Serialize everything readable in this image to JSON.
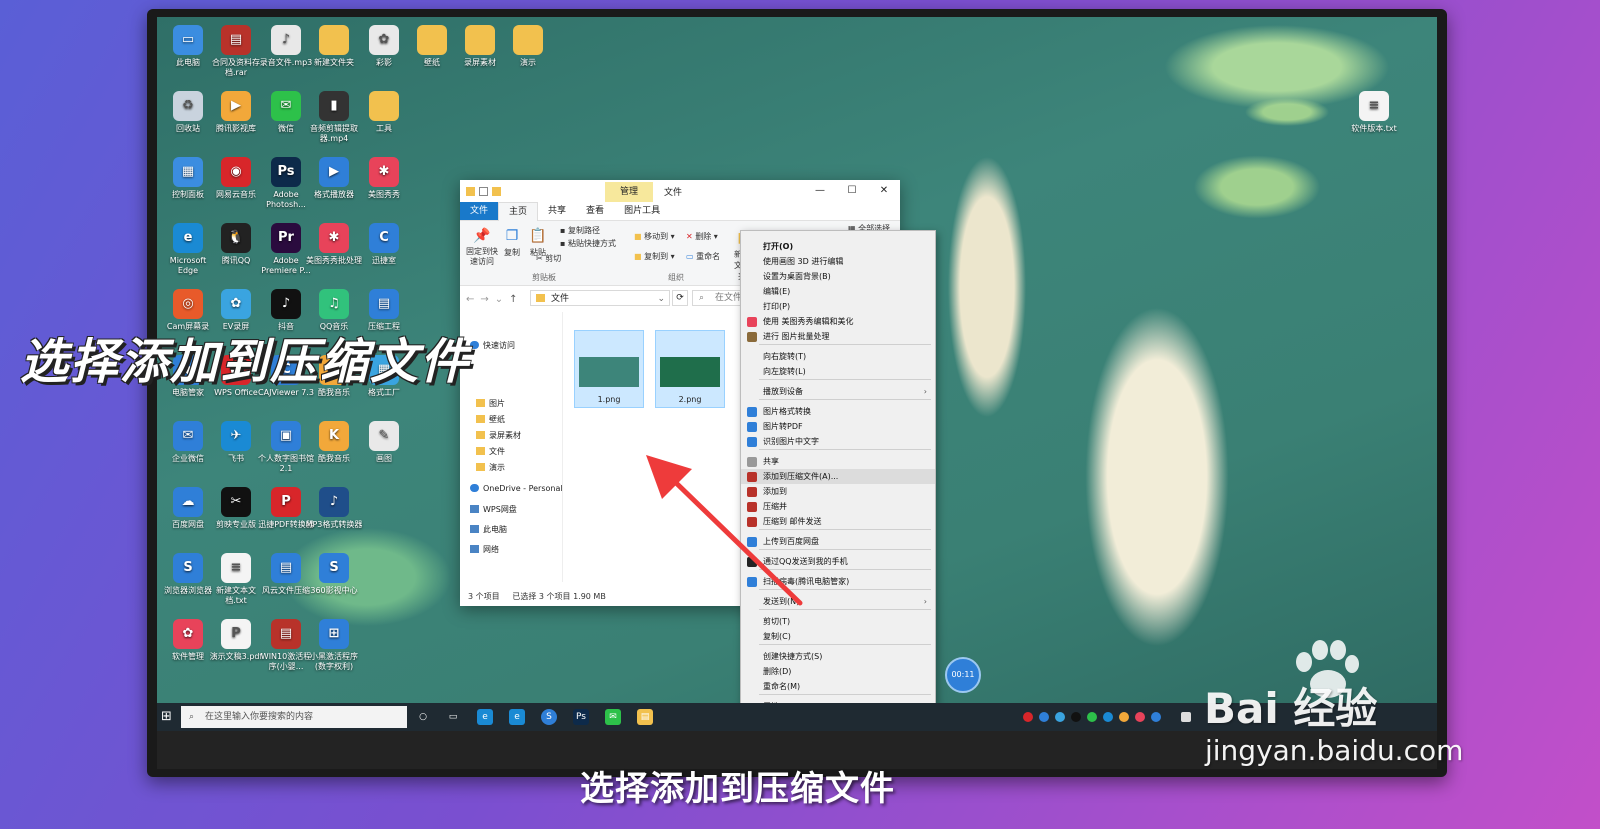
{
  "desktop_icons": [
    {
      "label": "此电脑",
      "color": "#3b8de0",
      "glyph": "▭"
    },
    {
      "label": "合同及资料存档.rar",
      "color": "#b8322a",
      "glyph": "▤"
    },
    {
      "label": "录音文件.mp3",
      "color": "#e8e8e8",
      "glyph": "♪"
    },
    {
      "label": "新建文件夹",
      "color": "#f2c14e",
      "glyph": ""
    },
    {
      "label": "彩影",
      "color": "#e9e9e9",
      "glyph": "✿"
    },
    {
      "label": "壁纸",
      "color": "#f2c14e",
      "glyph": ""
    },
    {
      "label": "录屏素材",
      "color": "#f2c14e",
      "glyph": ""
    },
    {
      "label": "演示",
      "color": "#f2c14e",
      "glyph": ""
    },
    {
      "label": "回收站",
      "color": "#c9d3de",
      "glyph": "♻"
    },
    {
      "label": "腾讯影视库",
      "color": "#f2a83a",
      "glyph": "▶"
    },
    {
      "label": "微信",
      "color": "#2dc14a",
      "glyph": "✉"
    },
    {
      "label": "音频剪辑提取器.mp4",
      "color": "#333333",
      "glyph": "▮"
    },
    {
      "label": "工具",
      "color": "#f2c14e",
      "glyph": ""
    },
    {
      "label": "控制面板",
      "color": "#3b8de0",
      "glyph": "▦"
    },
    {
      "label": "网易云音乐",
      "color": "#d8262a",
      "glyph": "◉"
    },
    {
      "label": "Adobe Photosh...",
      "color": "#0d2a4a",
      "glyph": "Ps"
    },
    {
      "label": "格式播放器",
      "color": "#2f7fd8",
      "glyph": "▶"
    },
    {
      "label": "美图秀秀",
      "color": "#e8435a",
      "glyph": "✱"
    },
    {
      "label": "Microsoft Edge",
      "color": "#1a8ad4",
      "glyph": "e"
    },
    {
      "label": "腾讯QQ",
      "color": "#222222",
      "glyph": "🐧"
    },
    {
      "label": "Adobe Premiere P...",
      "color": "#2a0b3e",
      "glyph": "Pr"
    },
    {
      "label": "美图秀秀批处理",
      "color": "#e8435a",
      "glyph": "✱"
    },
    {
      "label": "迅捷室",
      "color": "#2f7fd8",
      "glyph": "C"
    },
    {
      "label": "Cam屏幕录",
      "color": "#e85a2a",
      "glyph": "◎"
    },
    {
      "label": "EV录屏",
      "color": "#3aa4e0",
      "glyph": "✿"
    },
    {
      "label": "抖音",
      "color": "#111111",
      "glyph": "♪"
    },
    {
      "label": "QQ音乐",
      "color": "#31c27c",
      "glyph": "♫"
    },
    {
      "label": "压缩工程",
      "color": "#2f7fd8",
      "glyph": "▤"
    },
    {
      "label": "电脑管家",
      "color": "#2f7fd8",
      "glyph": "◆"
    },
    {
      "label": "WPS Office",
      "color": "#d8262a",
      "glyph": "W"
    },
    {
      "label": "CAJViewer 7.3",
      "color": "#2f7fd8",
      "glyph": "C"
    },
    {
      "label": "酷我音乐",
      "color": "#f2a83a",
      "glyph": "♫"
    },
    {
      "label": "格式工厂",
      "color": "#3aa4e0",
      "glyph": "▦"
    },
    {
      "label": "企业微信",
      "color": "#2f7fd8",
      "glyph": "✉"
    },
    {
      "label": "飞书",
      "color": "#1a8ad4",
      "glyph": "✈"
    },
    {
      "label": "个人数字图书馆2.1",
      "color": "#2f7fd8",
      "glyph": "▣"
    },
    {
      "label": "酷我音乐",
      "color": "#f2a83a",
      "glyph": "K"
    },
    {
      "label": "画图",
      "color": "#e9e9e9",
      "glyph": "✎"
    },
    {
      "label": "百度网盘",
      "color": "#2f7fd8",
      "glyph": "☁"
    },
    {
      "label": "剪映专业版",
      "color": "#111111",
      "glyph": "✂"
    },
    {
      "label": "迅捷PDF转换器",
      "color": "#d8262a",
      "glyph": "P"
    },
    {
      "label": "MP3格式转换器",
      "color": "#1f4e8a",
      "glyph": "♪"
    },
    {
      "label": "浏览器浏览器",
      "color": "#2f7fd8",
      "glyph": "S"
    },
    {
      "label": "新建文本文档.txt",
      "color": "#f4f4f4",
      "glyph": "≡"
    },
    {
      "label": "风云文件压缩",
      "color": "#2f7fd8",
      "glyph": "▤"
    },
    {
      "label": "360影视中心",
      "color": "#2f7fd8",
      "glyph": "S"
    },
    {
      "label": "软件管理",
      "color": "#e8435a",
      "glyph": "✿"
    },
    {
      "label": "演示文稿3.pdf",
      "color": "#f4f4f4",
      "glyph": "P"
    },
    {
      "label": "WIN10激活程序(小婴...",
      "color": "#b8322a",
      "glyph": "▤"
    },
    {
      "label": "小黑激活程序(数字权利)",
      "color": "#2f7fd8",
      "glyph": "⊞"
    },
    {
      "label": "软件版本.txt",
      "color": "#f4f4f4",
      "glyph": "≡"
    }
  ],
  "explorer": {
    "manage_tab": "管理",
    "title": "文件",
    "tabs": [
      "文件",
      "主页",
      "共享",
      "查看",
      "图片工具"
    ],
    "ribbon": {
      "pin": "固定到快速访问",
      "copy": "复制",
      "paste": "粘贴",
      "copy_path": "复制路径",
      "paste_shortcut": "粘贴快捷方式",
      "cut": "剪切",
      "clipboard_group": "剪贴板",
      "move_to": "移动到",
      "copy_to": "复制到",
      "delete": "删除",
      "rename": "重命名",
      "organize_group": "组织",
      "new": "新建",
      "new_folder": "文件夹",
      "select_all": "全部选择"
    },
    "address": "文件",
    "search_placeholder": "在文件中",
    "nav_items": [
      "快速访问",
      "图片",
      "壁纸",
      "录屏素材",
      "文件",
      "演示",
      "OneDrive - Personal",
      "WPS网盘",
      "此电脑",
      "网络"
    ],
    "files": [
      {
        "name": "1.png"
      },
      {
        "name": "2.png"
      }
    ],
    "status_count": "3 个项目",
    "status_selected": "已选择 3 个项目  1.90 MB"
  },
  "context_menu": {
    "items": [
      {
        "label": "打开(O)",
        "bold": true
      },
      {
        "label": "使用画图 3D 进行编辑"
      },
      {
        "label": "设置为桌面背景(B)"
      },
      {
        "label": "编辑(E)"
      },
      {
        "label": "打印(P)"
      },
      {
        "label": "使用 美图秀秀编辑和美化",
        "icon_color": "#e8435a"
      },
      {
        "label": "进行 图片批量处理",
        "icon_color": "#8a6a3a"
      },
      {
        "label": "向右旋转(T)"
      },
      {
        "label": "向左旋转(L)"
      },
      {
        "label": "播放到设备",
        "submenu": true
      },
      {
        "label": "图片格式转换",
        "icon_color": "#2f7fd8"
      },
      {
        "label": "图片转PDF",
        "icon_color": "#2f7fd8"
      },
      {
        "label": "识别图片中文字",
        "icon_color": "#2f7fd8"
      },
      {
        "label": "共享",
        "icon_color": "#999999"
      },
      {
        "label": "添加到压缩文件(A)...",
        "icon_color": "#b8322a",
        "highlight": true
      },
      {
        "label": "添加到",
        "icon_color": "#b8322a"
      },
      {
        "label": "压缩并",
        "icon_color": "#b8322a"
      },
      {
        "label": "压缩到   邮件发送",
        "icon_color": "#b8322a"
      },
      {
        "label": "上传到百度网盘",
        "icon_color": "#2f7fd8"
      },
      {
        "label": "通过QQ发送到我的手机",
        "icon_color": "#222222"
      },
      {
        "label": "扫描病毒(腾讯电脑管家)",
        "icon_color": "#2f7fd8"
      },
      {
        "label": "发送到(N)",
        "submenu": true
      },
      {
        "label": "剪切(T)"
      },
      {
        "label": "复制(C)"
      },
      {
        "label": "创建快捷方式(S)"
      },
      {
        "label": "删除(D)"
      },
      {
        "label": "重命名(M)"
      },
      {
        "label": "属性(R)"
      }
    ]
  },
  "taskbar": {
    "search_placeholder": "在这里输入你要搜索的内容"
  },
  "clock_badge": "00:11",
  "caption_big": "选择添加到压缩文件",
  "caption_sub": "选择添加到压缩文件",
  "watermark": {
    "logo": "Bai 经验",
    "url": "jingyan.baidu.com"
  },
  "colors": {
    "accent": "#1979ca",
    "arrow": "#ee3b3b"
  }
}
